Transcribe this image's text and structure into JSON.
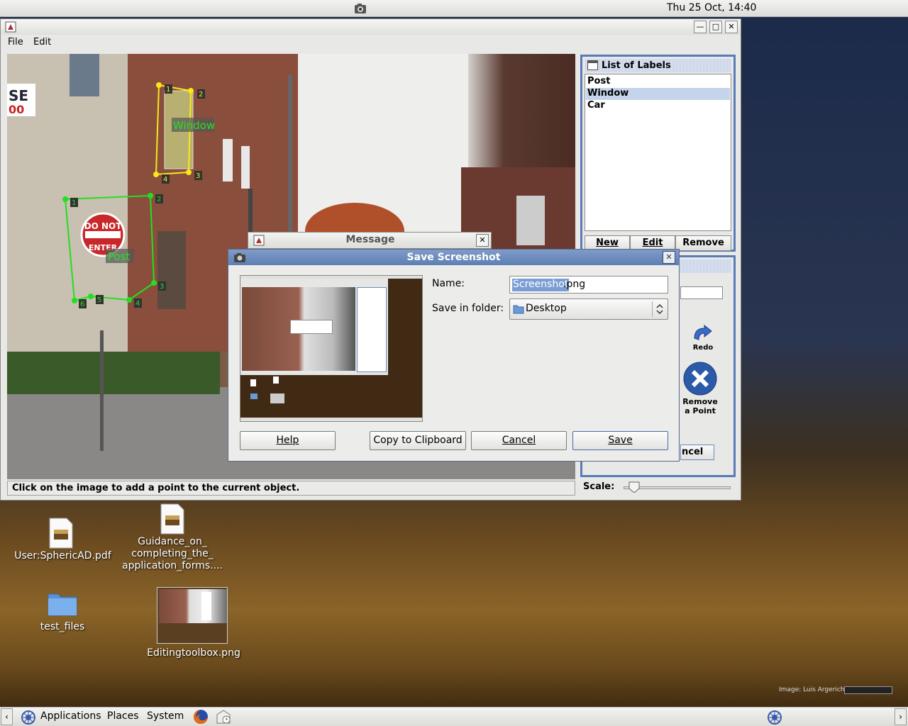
{
  "top_panel": {
    "clock": "Thu 25 Oct, 14:40"
  },
  "main_window": {
    "menu": {
      "file": "File",
      "edit": "Edit"
    },
    "status_text": "Click on the image to add a point to the current object.",
    "annotations": {
      "window_label": "Window",
      "post_label": "Post",
      "window_points": [
        "1",
        "2",
        "3",
        "4"
      ],
      "post_points": [
        "1",
        "2",
        "3",
        "4",
        "5",
        "6"
      ]
    },
    "scene_text": {
      "sign_line1": "DO NOT",
      "sign_line2": "ENTER",
      "bldg1": "SE",
      "bldg2": "00"
    }
  },
  "labels_panel": {
    "title": "List of Labels",
    "items": [
      "Post",
      "Window",
      "Car"
    ],
    "selected": "Window",
    "buttons": {
      "new": "New",
      "edit": "Edit",
      "remove": "Remove"
    }
  },
  "toolbox": {
    "redo": "Redo",
    "remove_point_line1": "Remove",
    "remove_point_line2": "a Point",
    "cancel_partial": "ncel",
    "scale_label": "Scale:",
    "scale_value": 0.05
  },
  "message_dialog": {
    "title": "Message"
  },
  "save_dialog": {
    "title": "Save Screenshot",
    "name_label": "Name:",
    "name_value_selected": "Screenshot",
    "name_value_rest": ".png",
    "folder_label": "Save in folder:",
    "folder_value": "Desktop",
    "buttons": {
      "help": "Help",
      "copy": "Copy to Clipboard",
      "cancel": "Cancel",
      "save": "Save"
    }
  },
  "desktop_icons": [
    {
      "label": "User:SphericAD.pdf"
    },
    {
      "label_lines": [
        "Guidance_on_",
        "completing_the_",
        "application_forms...."
      ]
    },
    {
      "label": "test_files"
    },
    {
      "label": "Editingtoolbox.png"
    }
  ],
  "wallpaper_credit": "Image: Luis Argerich",
  "bottom_panel": {
    "applications": "Applications",
    "places": "Places",
    "system": "System"
  }
}
